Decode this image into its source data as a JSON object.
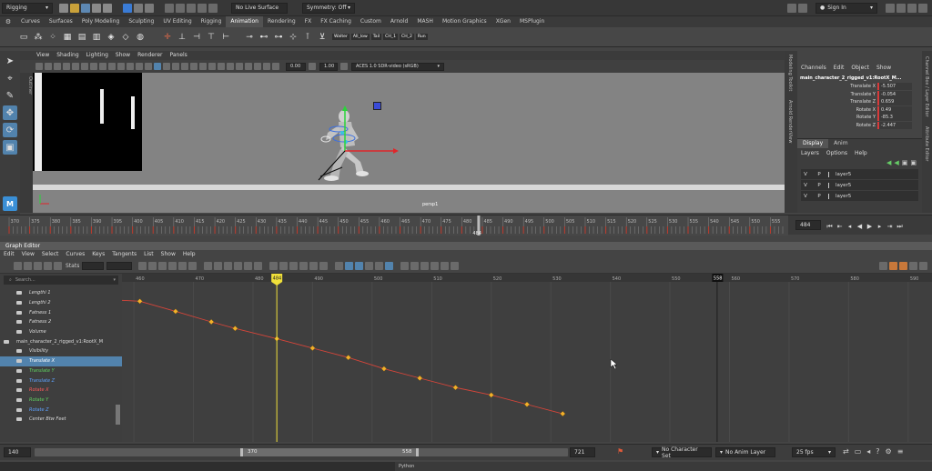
{
  "status_line": {
    "menu_set": "Rigging",
    "live_surface": "No Live Surface",
    "symmetry": "Symmetry: Off",
    "sign_in": "Sign In"
  },
  "shelf": {
    "tabs": [
      "Curves",
      "Surfaces",
      "Poly Modeling",
      "Sculpting",
      "UV Editing",
      "Rigging",
      "Animation",
      "Rendering",
      "FX",
      "FX Caching",
      "Custom",
      "Arnold",
      "MASH",
      "Motion Graphics",
      "XGen",
      "MSPlugin"
    ],
    "active_tab": "Animation",
    "labels": [
      "Walter",
      "All_low",
      "Tail",
      "CH_1",
      "CH_2",
      "Run"
    ]
  },
  "viewport": {
    "menu": [
      "View",
      "Shading",
      "Lighting",
      "Show",
      "Renderer",
      "Panels"
    ],
    "exposure": "0.00",
    "gamma": "1.00",
    "color_space": "ACES 1.0 SDR-video (sRGB)",
    "camera_label": "persp1",
    "outliner_tab": "Outliner"
  },
  "right_strip_tabs": [
    "Modeling Toolkit",
    "Arnold RenderView"
  ],
  "far_right_tabs": [
    "Channel Box / Layer Editor",
    "Attribute Editor"
  ],
  "channel_box": {
    "menu": [
      "Channels",
      "Edit",
      "Object",
      "Show"
    ],
    "object_name": "main_character_2_rigged_v1:RootX_M...",
    "channels": [
      {
        "name": "Translate X",
        "value": "-5.507"
      },
      {
        "name": "Translate Y",
        "value": "-0.054"
      },
      {
        "name": "Translate Z",
        "value": "0.659"
      },
      {
        "name": "Rotate X",
        "value": "0.49"
      },
      {
        "name": "Rotate Y",
        "value": "-85.3"
      },
      {
        "name": "Rotate Z",
        "value": "-2.447"
      }
    ],
    "layer_tabs": [
      "Display",
      "Anim"
    ],
    "layer_menu": [
      "Layers",
      "Options",
      "Help"
    ],
    "layers": [
      {
        "v": "V",
        "p": "P",
        "name": "layer5"
      },
      {
        "v": "V",
        "p": "P",
        "name": "layer5"
      },
      {
        "v": "V",
        "p": "P",
        "name": "layer5"
      }
    ]
  },
  "timeslider": {
    "start": 370,
    "end": 558,
    "ticks": [
      370,
      375,
      380,
      385,
      390,
      395,
      400,
      405,
      410,
      415,
      420,
      425,
      430,
      435,
      440,
      445,
      450,
      455,
      460,
      465,
      470,
      475,
      480,
      485,
      490,
      495,
      500,
      505,
      510,
      515,
      520,
      525,
      530,
      535,
      540,
      545,
      550,
      555
    ],
    "current_frame": "484",
    "current_field": "484"
  },
  "graph_editor": {
    "title": "Graph Editor",
    "menu": [
      "Edit",
      "View",
      "Select",
      "Curves",
      "Keys",
      "Tangents",
      "List",
      "Show",
      "Help"
    ],
    "stats_label": "Stats",
    "search_placeholder": "Search...",
    "current_frame": "484",
    "end_marker": "558",
    "outliner": [
      {
        "label": "Lengthi 1",
        "color": "#dddddd",
        "sel": false
      },
      {
        "label": "Lengthi 2",
        "color": "#dddddd",
        "sel": false
      },
      {
        "label": "Fatness 1",
        "color": "#dddddd",
        "sel": false
      },
      {
        "label": "Fatness 2",
        "color": "#dddddd",
        "sel": false
      },
      {
        "label": "Volume",
        "color": "#dddddd",
        "sel": false
      },
      {
        "label": "main_character_2_rigged_v1:RootX_M",
        "color": "#dddddd",
        "sel": false
      },
      {
        "label": "Visibility",
        "color": "#dddddd",
        "sel": false
      },
      {
        "label": "Translate X",
        "color": "#ffffff",
        "sel": true
      },
      {
        "label": "Translate Y",
        "color": "#5fd25f",
        "sel": false
      },
      {
        "label": "Translate Z",
        "color": "#5ea2ff",
        "sel": false
      },
      {
        "label": "Rotate X",
        "color": "#ff5a5a",
        "sel": false
      },
      {
        "label": "Rotate Y",
        "color": "#5fd25f",
        "sel": false
      },
      {
        "label": "Rotate Z",
        "color": "#5ea2ff",
        "sel": false
      },
      {
        "label": "Center Btw Feet",
        "color": "#dddddd",
        "sel": false
      }
    ],
    "frame_ticks": [
      460,
      470,
      480,
      490,
      500,
      510,
      520,
      530,
      540,
      550,
      560,
      570,
      580,
      590
    ],
    "keys": [
      {
        "frame": 461,
        "value": 0.0
      },
      {
        "frame": 467,
        "value": -0.054
      },
      {
        "frame": 473,
        "value": -0.11
      },
      {
        "frame": 477,
        "value": -0.145
      },
      {
        "frame": 484,
        "value": -0.2
      },
      {
        "frame": 490,
        "value": -0.25
      },
      {
        "frame": 496,
        "value": -0.3
      },
      {
        "frame": 502,
        "value": -0.36
      },
      {
        "frame": 508,
        "value": -0.41
      },
      {
        "frame": 514,
        "value": -0.46
      },
      {
        "frame": 520,
        "value": -0.5
      },
      {
        "frame": 526,
        "value": -0.55
      },
      {
        "frame": 532,
        "value": -0.6
      }
    ]
  },
  "range_slider": {
    "start": "140",
    "inner_start": "370",
    "inner_end": "558",
    "end": "721",
    "character_set": "No Character Set",
    "anim_layer": "No Anim Layer",
    "fps": "25 fps"
  },
  "helpline": {
    "tab": "Python"
  },
  "colors": {
    "accent": "#5283ad",
    "curve": "#d6453a",
    "key": "#f2b02a",
    "current_time": "#f0e03a"
  }
}
